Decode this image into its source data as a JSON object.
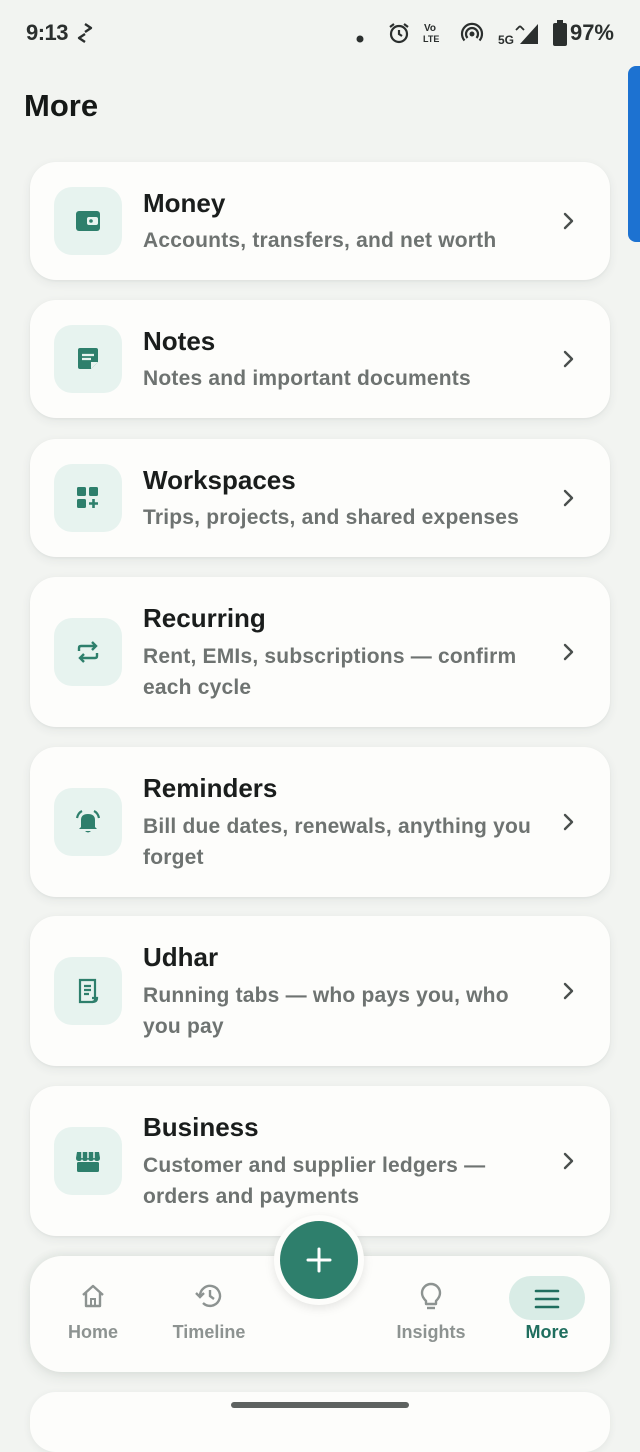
{
  "status_bar": {
    "time": "9:13",
    "battery": "97%",
    "network": "5G",
    "volte": "Vo LTE",
    "icons": [
      "sync-icon",
      "dot-icon",
      "alarm-icon",
      "volte-icon",
      "hotspot-icon",
      "signal-icon",
      "battery-icon"
    ]
  },
  "page": {
    "title": "More"
  },
  "menu": [
    {
      "title": "Money",
      "subtitle": "Accounts, transfers, and net worth",
      "icon": "wallet-icon"
    },
    {
      "title": "Notes",
      "subtitle": "Notes and important documents",
      "icon": "note-icon"
    },
    {
      "title": "Workspaces",
      "subtitle": "Trips, projects, and shared expenses",
      "icon": "workspace-grid-icon"
    },
    {
      "title": "Recurring",
      "subtitle": "Rent, EMIs, subscriptions — confirm each cycle",
      "icon": "repeat-icon"
    },
    {
      "title": "Reminders",
      "subtitle": "Bill due dates, renewals, anything you forget",
      "icon": "bell-icon"
    },
    {
      "title": "Udhar",
      "subtitle": "Running tabs — who pays you, who you pay",
      "icon": "receipt-icon"
    },
    {
      "title": "Business",
      "subtitle": "Customer and supplier ledgers — orders and payments",
      "icon": "store-icon"
    }
  ],
  "nav": {
    "home": "Home",
    "timeline": "Timeline",
    "insights": "Insights",
    "more": "More",
    "active": "more"
  },
  "colors": {
    "accent": "#2e7f6c",
    "icon_tile": "#e7f3ef",
    "background": "#f2f4f1",
    "active_nav": "#1f6e5e"
  }
}
